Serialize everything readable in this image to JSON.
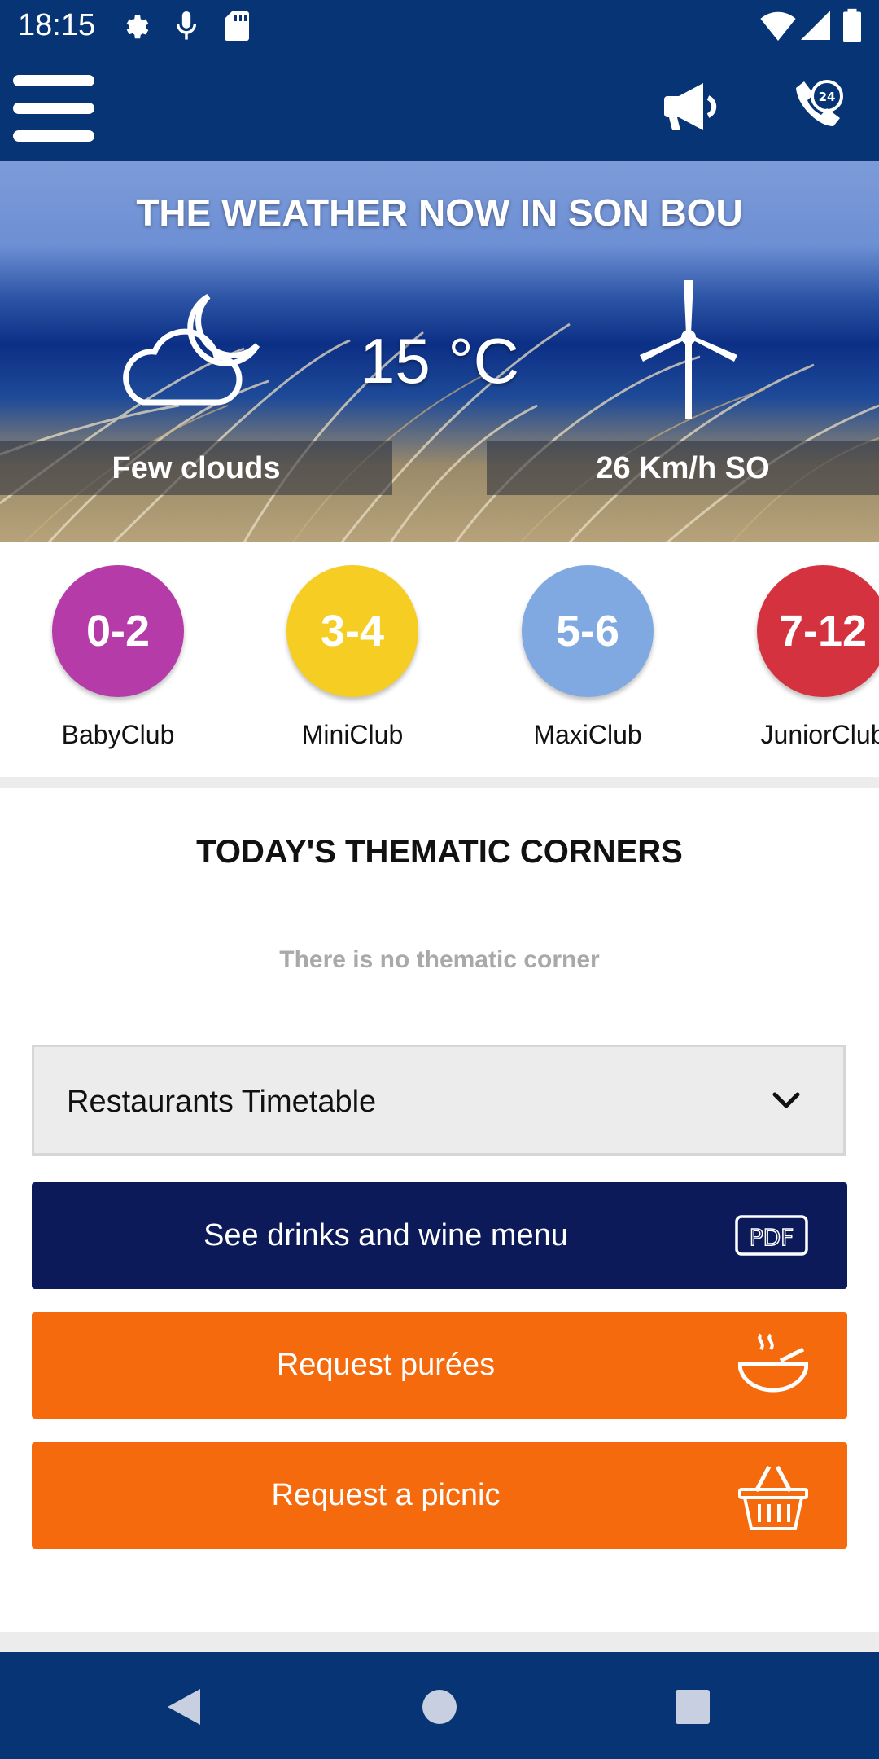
{
  "status_bar": {
    "time": "18:15",
    "icons": [
      "settings-icon",
      "mic-icon",
      "sd-card-icon",
      "wifi-icon",
      "signal-icon",
      "battery-icon"
    ]
  },
  "app_bar": {
    "icons": [
      "menu-icon",
      "megaphone-icon",
      "phone-24h-icon"
    ]
  },
  "weather": {
    "title": "THE WEATHER NOW IN SON BOU",
    "temperature": "15 °C",
    "condition": "Few clouds",
    "wind": "26 Km/h  SO",
    "icons": [
      "cloud-moon-icon",
      "wind-turbine-icon"
    ]
  },
  "clubs": [
    {
      "age": "0-2",
      "label": "BabyClub",
      "color": "#b43ba8"
    },
    {
      "age": "3-4",
      "label": "MiniClub",
      "color": "#f6cd22"
    },
    {
      "age": "5-6",
      "label": "MaxiClub",
      "color": "#80a9e2"
    },
    {
      "age": "7-12",
      "label": "JuniorClub",
      "color": "#d5323f"
    }
  ],
  "thematic": {
    "title": "TODAY'S THEMATIC CORNERS",
    "empty_text": "There is no thematic corner"
  },
  "restaurants": {
    "dropdown_label": "Restaurants Timetable"
  },
  "buttons": {
    "drinks_menu": "See drinks and wine menu",
    "purees": "Request purées",
    "picnic": "Request a picnic"
  },
  "colors": {
    "primary": "#073475",
    "navy_button": "#0d1a5a",
    "orange_button": "#f56a0c"
  }
}
